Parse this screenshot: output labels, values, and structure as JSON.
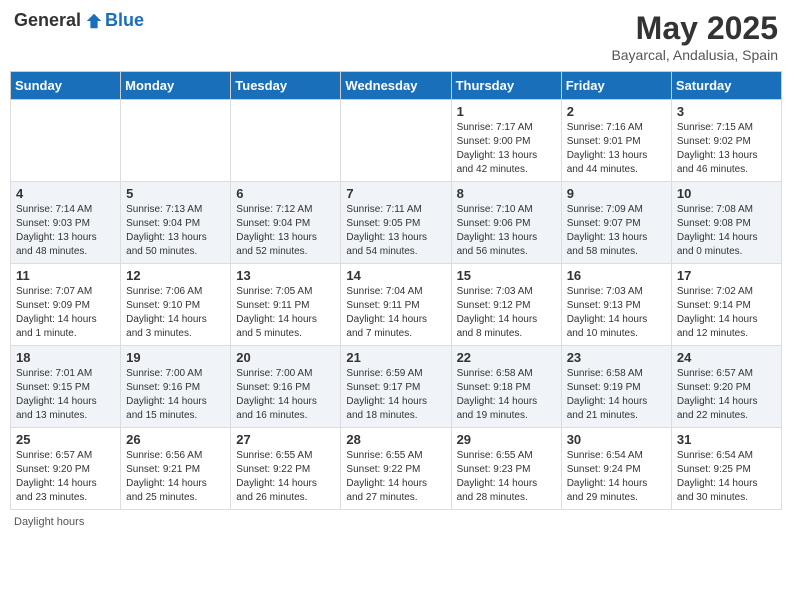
{
  "header": {
    "logo_general": "General",
    "logo_blue": "Blue",
    "month_title": "May 2025",
    "location": "Bayarcal, Andalusia, Spain"
  },
  "days_of_week": [
    "Sunday",
    "Monday",
    "Tuesday",
    "Wednesday",
    "Thursday",
    "Friday",
    "Saturday"
  ],
  "footer": {
    "daylight_label": "Daylight hours"
  },
  "weeks": [
    [
      {
        "day": "",
        "info": ""
      },
      {
        "day": "",
        "info": ""
      },
      {
        "day": "",
        "info": ""
      },
      {
        "day": "",
        "info": ""
      },
      {
        "day": "1",
        "info": "Sunrise: 7:17 AM\nSunset: 9:00 PM\nDaylight: 13 hours\nand 42 minutes."
      },
      {
        "day": "2",
        "info": "Sunrise: 7:16 AM\nSunset: 9:01 PM\nDaylight: 13 hours\nand 44 minutes."
      },
      {
        "day": "3",
        "info": "Sunrise: 7:15 AM\nSunset: 9:02 PM\nDaylight: 13 hours\nand 46 minutes."
      }
    ],
    [
      {
        "day": "4",
        "info": "Sunrise: 7:14 AM\nSunset: 9:03 PM\nDaylight: 13 hours\nand 48 minutes."
      },
      {
        "day": "5",
        "info": "Sunrise: 7:13 AM\nSunset: 9:04 PM\nDaylight: 13 hours\nand 50 minutes."
      },
      {
        "day": "6",
        "info": "Sunrise: 7:12 AM\nSunset: 9:04 PM\nDaylight: 13 hours\nand 52 minutes."
      },
      {
        "day": "7",
        "info": "Sunrise: 7:11 AM\nSunset: 9:05 PM\nDaylight: 13 hours\nand 54 minutes."
      },
      {
        "day": "8",
        "info": "Sunrise: 7:10 AM\nSunset: 9:06 PM\nDaylight: 13 hours\nand 56 minutes."
      },
      {
        "day": "9",
        "info": "Sunrise: 7:09 AM\nSunset: 9:07 PM\nDaylight: 13 hours\nand 58 minutes."
      },
      {
        "day": "10",
        "info": "Sunrise: 7:08 AM\nSunset: 9:08 PM\nDaylight: 14 hours\nand 0 minutes."
      }
    ],
    [
      {
        "day": "11",
        "info": "Sunrise: 7:07 AM\nSunset: 9:09 PM\nDaylight: 14 hours\nand 1 minute."
      },
      {
        "day": "12",
        "info": "Sunrise: 7:06 AM\nSunset: 9:10 PM\nDaylight: 14 hours\nand 3 minutes."
      },
      {
        "day": "13",
        "info": "Sunrise: 7:05 AM\nSunset: 9:11 PM\nDaylight: 14 hours\nand 5 minutes."
      },
      {
        "day": "14",
        "info": "Sunrise: 7:04 AM\nSunset: 9:11 PM\nDaylight: 14 hours\nand 7 minutes."
      },
      {
        "day": "15",
        "info": "Sunrise: 7:03 AM\nSunset: 9:12 PM\nDaylight: 14 hours\nand 8 minutes."
      },
      {
        "day": "16",
        "info": "Sunrise: 7:03 AM\nSunset: 9:13 PM\nDaylight: 14 hours\nand 10 minutes."
      },
      {
        "day": "17",
        "info": "Sunrise: 7:02 AM\nSunset: 9:14 PM\nDaylight: 14 hours\nand 12 minutes."
      }
    ],
    [
      {
        "day": "18",
        "info": "Sunrise: 7:01 AM\nSunset: 9:15 PM\nDaylight: 14 hours\nand 13 minutes."
      },
      {
        "day": "19",
        "info": "Sunrise: 7:00 AM\nSunset: 9:16 PM\nDaylight: 14 hours\nand 15 minutes."
      },
      {
        "day": "20",
        "info": "Sunrise: 7:00 AM\nSunset: 9:16 PM\nDaylight: 14 hours\nand 16 minutes."
      },
      {
        "day": "21",
        "info": "Sunrise: 6:59 AM\nSunset: 9:17 PM\nDaylight: 14 hours\nand 18 minutes."
      },
      {
        "day": "22",
        "info": "Sunrise: 6:58 AM\nSunset: 9:18 PM\nDaylight: 14 hours\nand 19 minutes."
      },
      {
        "day": "23",
        "info": "Sunrise: 6:58 AM\nSunset: 9:19 PM\nDaylight: 14 hours\nand 21 minutes."
      },
      {
        "day": "24",
        "info": "Sunrise: 6:57 AM\nSunset: 9:20 PM\nDaylight: 14 hours\nand 22 minutes."
      }
    ],
    [
      {
        "day": "25",
        "info": "Sunrise: 6:57 AM\nSunset: 9:20 PM\nDaylight: 14 hours\nand 23 minutes."
      },
      {
        "day": "26",
        "info": "Sunrise: 6:56 AM\nSunset: 9:21 PM\nDaylight: 14 hours\nand 25 minutes."
      },
      {
        "day": "27",
        "info": "Sunrise: 6:55 AM\nSunset: 9:22 PM\nDaylight: 14 hours\nand 26 minutes."
      },
      {
        "day": "28",
        "info": "Sunrise: 6:55 AM\nSunset: 9:22 PM\nDaylight: 14 hours\nand 27 minutes."
      },
      {
        "day": "29",
        "info": "Sunrise: 6:55 AM\nSunset: 9:23 PM\nDaylight: 14 hours\nand 28 minutes."
      },
      {
        "day": "30",
        "info": "Sunrise: 6:54 AM\nSunset: 9:24 PM\nDaylight: 14 hours\nand 29 minutes."
      },
      {
        "day": "31",
        "info": "Sunrise: 6:54 AM\nSunset: 9:25 PM\nDaylight: 14 hours\nand 30 minutes."
      }
    ]
  ]
}
